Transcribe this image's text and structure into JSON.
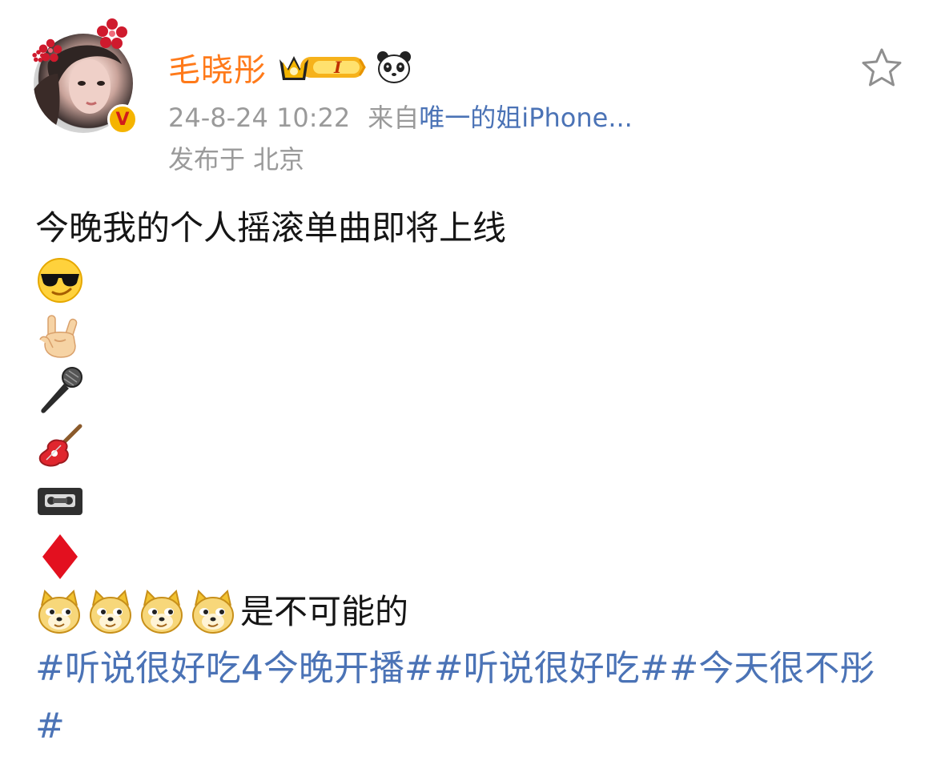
{
  "author": {
    "name": "毛晓彤",
    "badges": [
      "crown-vip-icon",
      "panda-icon"
    ],
    "verified_mark": "V"
  },
  "post_meta": {
    "time": "24-8-24 10:22",
    "source_prefix": "来自",
    "source": "唯一的姐iPhone...",
    "location": "发布于 北京"
  },
  "content": {
    "line1": "今晚我的个人摇滚单曲即将上线",
    "emoji_lines": [
      "sunglasses-emoji",
      "rock-hand-emoji",
      "microphone-emoji",
      "guitar-emoji",
      "videocassette-emoji",
      "red-diamond-emoji"
    ],
    "doge_suffix": "是不可能的",
    "hashtags": "#听说很好吃4今晚开播##听说很好吃##今天很不彤#"
  },
  "colors": {
    "name": "#ff7a1a",
    "link": "#4b73b6",
    "meta": "#9a9a9a"
  }
}
